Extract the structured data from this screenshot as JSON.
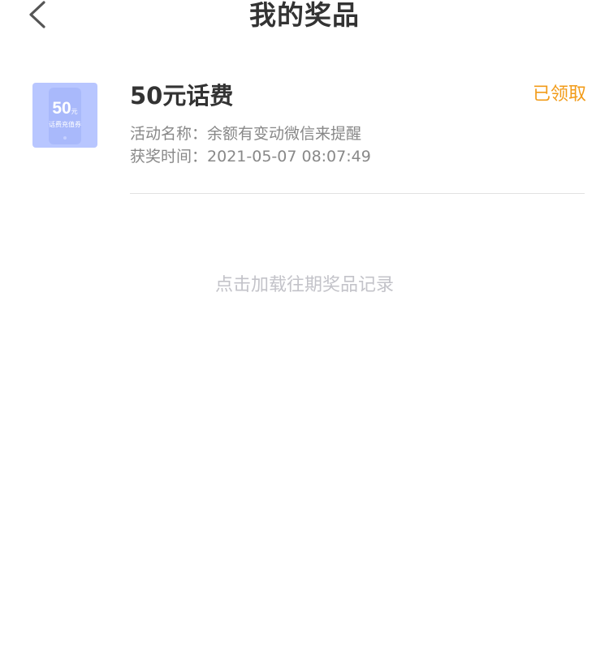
{
  "header": {
    "title": "我的奖品",
    "back_icon": "chevron-left-icon"
  },
  "prizes": [
    {
      "thumbnail": {
        "icon": "phone-credit-voucher-icon",
        "value": "50",
        "unit": "元",
        "caption": "话费充值券",
        "color": "#b8c6ff"
      },
      "name": "50元话费",
      "status": "已领取",
      "status_color": "#f29b18",
      "activity_label": "活动名称：",
      "activity_name": "余额有变动微信来提醒",
      "time_label": "获奖时间：",
      "time": "2021-05-07 08:07:49"
    }
  ],
  "load_more": "点击加载往期奖品记录"
}
